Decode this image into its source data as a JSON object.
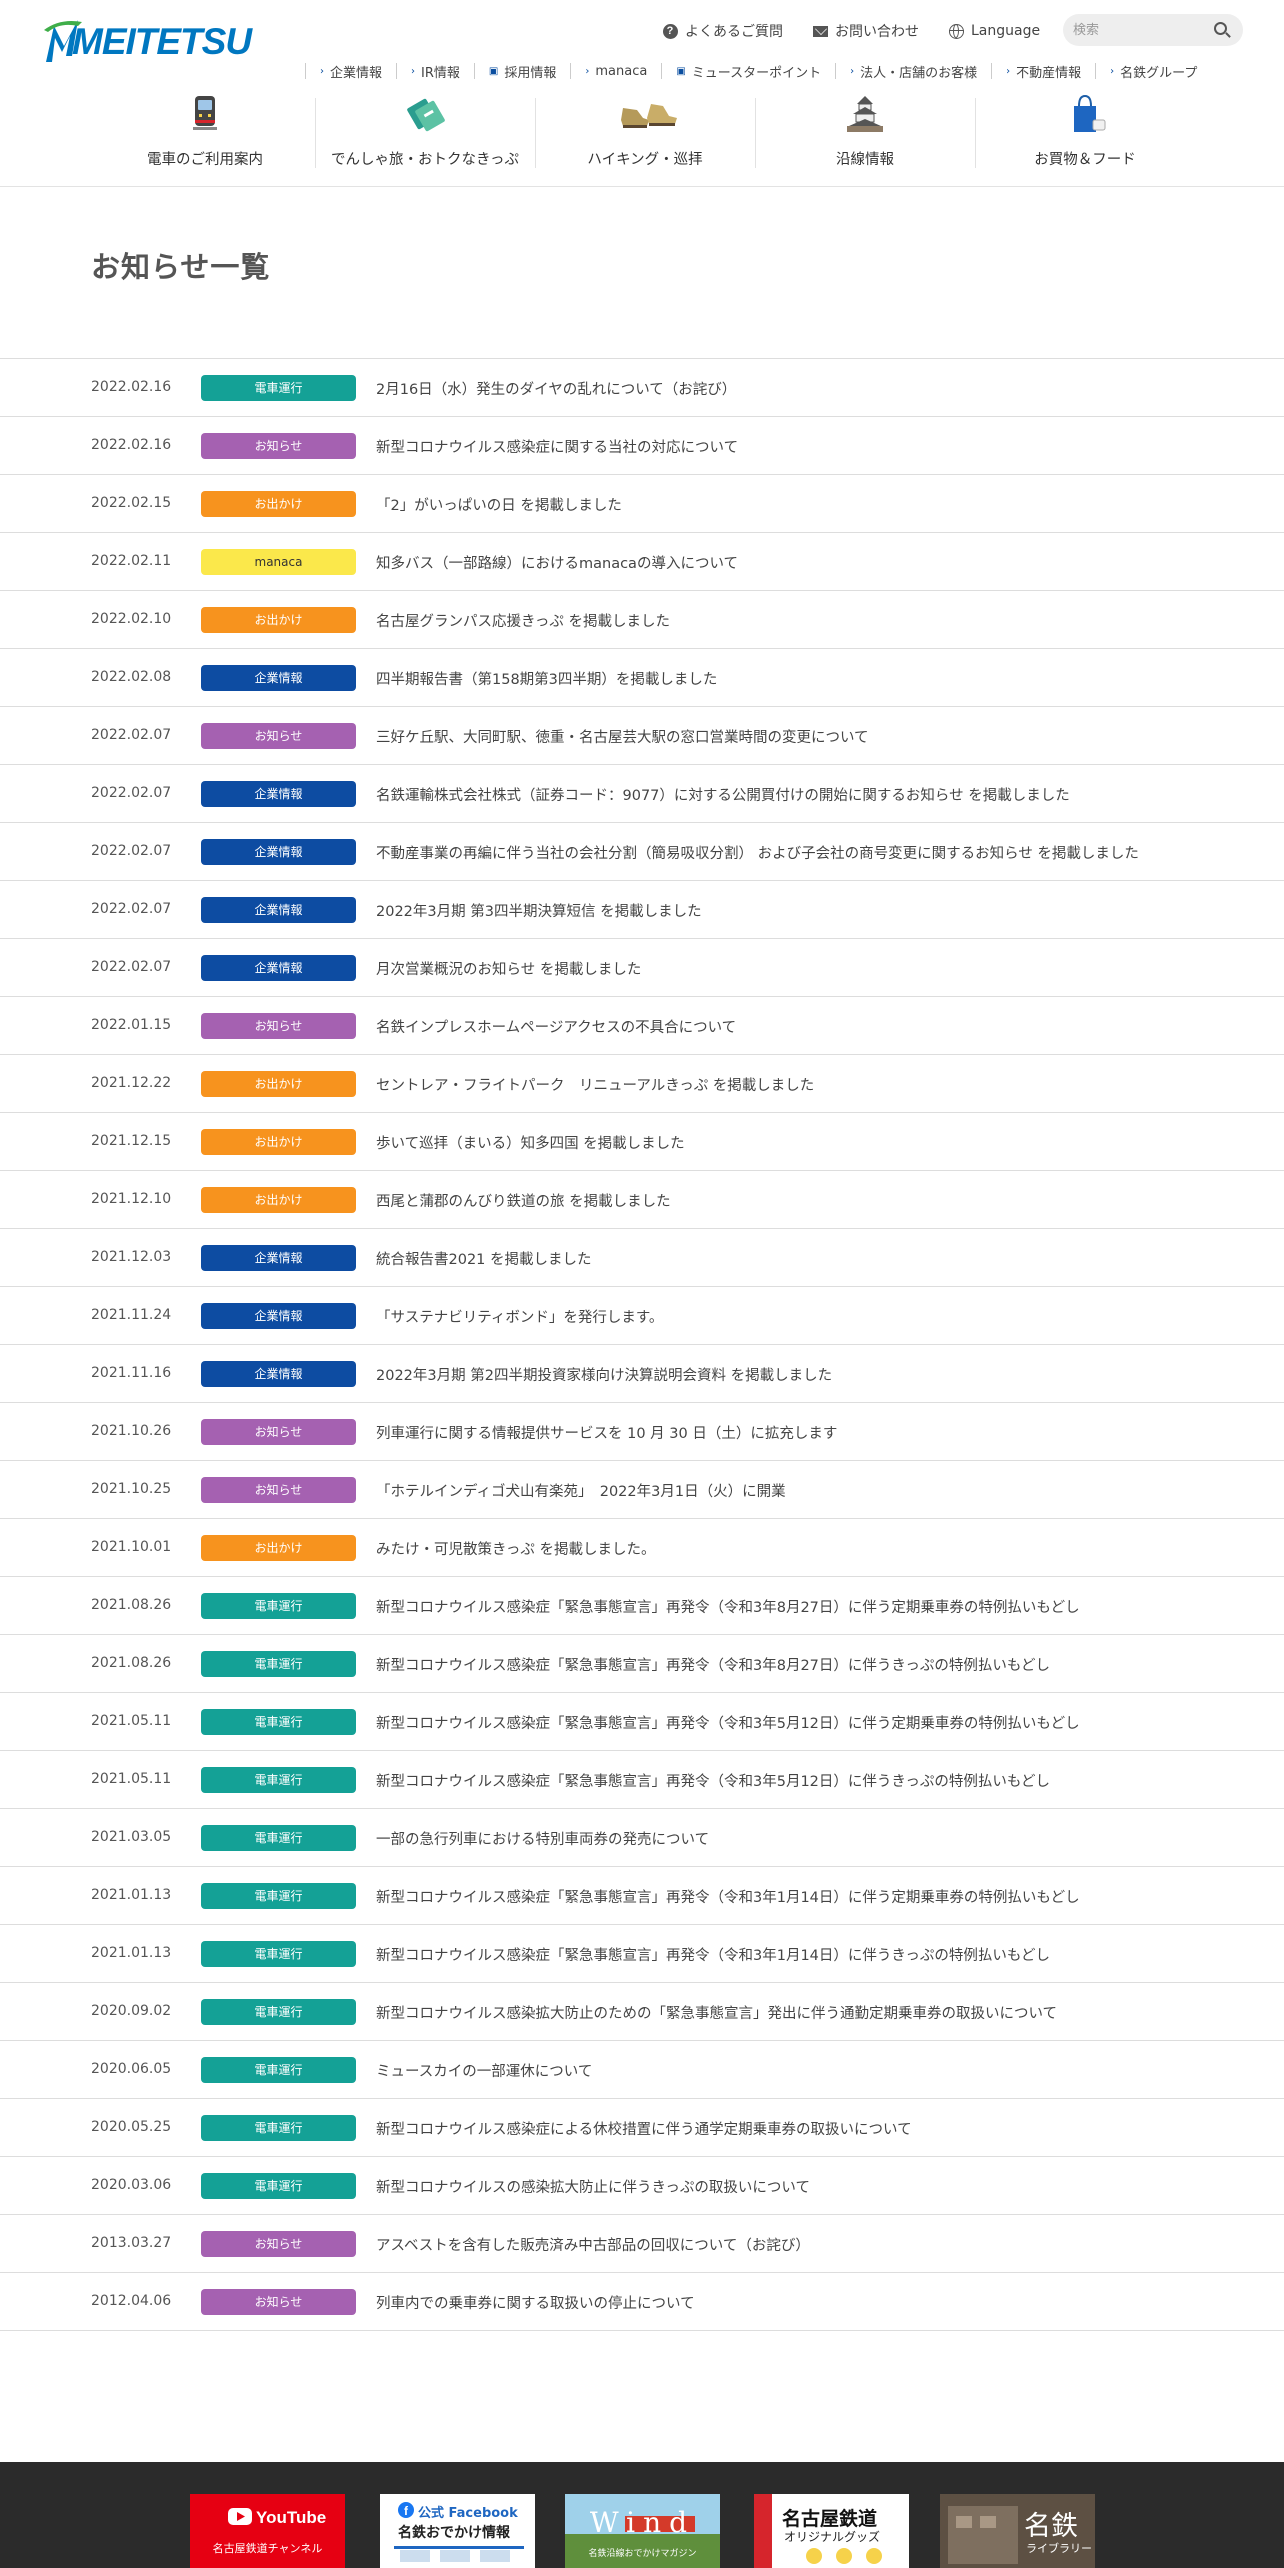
{
  "logo": {
    "text": "MEITETSU"
  },
  "util": {
    "faq": "よくあるご質問",
    "contact": "お問い合わせ",
    "language": "Language",
    "search_placeholder": "検索"
  },
  "subnav": [
    "企業情報",
    "IR情報",
    "採用情報",
    "manaca",
    "ミュースターポイント",
    "法人・店舗のお客様",
    "不動産情報",
    "名鉄グループ"
  ],
  "mainnav": [
    {
      "label": "電車のご利用案内",
      "icon": "train-icon"
    },
    {
      "label": "でんしゃ旅・おトクなきっぷ",
      "icon": "ticket-icon"
    },
    {
      "label": "ハイキング・巡拝",
      "icon": "hiking-boots-icon"
    },
    {
      "label": "沿線情報",
      "icon": "castle-icon"
    },
    {
      "label": "お買物＆フード",
      "icon": "shopping-bag-icon"
    }
  ],
  "page_title": "お知らせ一覧",
  "news": [
    {
      "date": "2022.02.16",
      "tag": "電車運行",
      "type": "train",
      "title": "2月16日（水）発生のダイヤの乱れについて（お詫び）"
    },
    {
      "date": "2022.02.16",
      "tag": "お知らせ",
      "type": "notice",
      "title": "新型コロナウイルス感染症に関する当社の対応について"
    },
    {
      "date": "2022.02.15",
      "tag": "お出かけ",
      "type": "outing",
      "title": "「2」がいっぱいの日 を掲載しました"
    },
    {
      "date": "2022.02.11",
      "tag": "manaca",
      "type": "manaca",
      "title": "知多バス（一部路線）におけるmanacaの導入について"
    },
    {
      "date": "2022.02.10",
      "tag": "お出かけ",
      "type": "outing",
      "title": "名古屋グランパス応援きっぷ を掲載しました"
    },
    {
      "date": "2022.02.08",
      "tag": "企業情報",
      "type": "corp",
      "title": "四半期報告書（第158期第3四半期）を掲載しました"
    },
    {
      "date": "2022.02.07",
      "tag": "お知らせ",
      "type": "notice",
      "title": "三好ケ丘駅、大同町駅、徳重・名古屋芸大駅の窓口営業時間の変更について"
    },
    {
      "date": "2022.02.07",
      "tag": "企業情報",
      "type": "corp",
      "title": "名鉄運輸株式会社株式（証券コード：9077）に対する公開買付けの開始に関するお知らせ を掲載しました"
    },
    {
      "date": "2022.02.07",
      "tag": "企業情報",
      "type": "corp",
      "title": "不動産事業の再編に伴う当社の会社分割（簡易吸収分割） および子会社の商号変更に関するお知らせ を掲載しました"
    },
    {
      "date": "2022.02.07",
      "tag": "企業情報",
      "type": "corp",
      "title": "2022年3月期 第3四半期決算短信 を掲載しました"
    },
    {
      "date": "2022.02.07",
      "tag": "企業情報",
      "type": "corp",
      "title": "月次営業概況のお知らせ を掲載しました"
    },
    {
      "date": "2022.01.15",
      "tag": "お知らせ",
      "type": "notice",
      "title": "名鉄インプレスホームページアクセスの不具合について"
    },
    {
      "date": "2021.12.22",
      "tag": "お出かけ",
      "type": "outing",
      "title": "セントレア・フライトパーク　リニューアルきっぷ を掲載しました"
    },
    {
      "date": "2021.12.15",
      "tag": "お出かけ",
      "type": "outing",
      "title": "歩いて巡拝（まいる）知多四国 を掲載しました"
    },
    {
      "date": "2021.12.10",
      "tag": "お出かけ",
      "type": "outing",
      "title": "西尾と蒲郡のんびり鉄道の旅 を掲載しました"
    },
    {
      "date": "2021.12.03",
      "tag": "企業情報",
      "type": "corp",
      "title": "統合報告書2021 を掲載しました"
    },
    {
      "date": "2021.11.24",
      "tag": "企業情報",
      "type": "corp",
      "title": "「サステナビリティボンド」を発行します。"
    },
    {
      "date": "2021.11.16",
      "tag": "企業情報",
      "type": "corp",
      "title": "2022年3月期 第2四半期投資家様向け決算説明会資料 を掲載しました"
    },
    {
      "date": "2021.10.26",
      "tag": "お知らせ",
      "type": "notice",
      "title": "列車運行に関する情報提供サービスを 10 月 30 日（土）に拡充します"
    },
    {
      "date": "2021.10.25",
      "tag": "お知らせ",
      "type": "notice",
      "title": "「ホテルインディゴ犬山有楽苑」　2022年3月1日（火）に開業"
    },
    {
      "date": "2021.10.01",
      "tag": "お出かけ",
      "type": "outing",
      "title": "みたけ・可児散策きっぷ を掲載しました。"
    },
    {
      "date": "2021.08.26",
      "tag": "電車運行",
      "type": "train",
      "title": "新型コロナウイルス感染症「緊急事態宣言」再発令（令和3年8月27日）に伴う定期乗車券の特例払いもどし"
    },
    {
      "date": "2021.08.26",
      "tag": "電車運行",
      "type": "train",
      "title": "新型コロナウイルス感染症「緊急事態宣言」再発令（令和3年8月27日）に伴うきっぷの特例払いもどし"
    },
    {
      "date": "2021.05.11",
      "tag": "電車運行",
      "type": "train",
      "title": "新型コロナウイルス感染症「緊急事態宣言」再発令（令和3年5月12日）に伴う定期乗車券の特例払いもどし"
    },
    {
      "date": "2021.05.11",
      "tag": "電車運行",
      "type": "train",
      "title": "新型コロナウイルス感染症「緊急事態宣言」再発令（令和3年5月12日）に伴うきっぷの特例払いもどし"
    },
    {
      "date": "2021.03.05",
      "tag": "電車運行",
      "type": "train",
      "title": "一部の急行列車における特別車両券の発売について"
    },
    {
      "date": "2021.01.13",
      "tag": "電車運行",
      "type": "train",
      "title": "新型コロナウイルス感染症「緊急事態宣言」再発令（令和3年1月14日）に伴う定期乗車券の特例払いもどし"
    },
    {
      "date": "2021.01.13",
      "tag": "電車運行",
      "type": "train",
      "title": "新型コロナウイルス感染症「緊急事態宣言」再発令（令和3年1月14日）に伴うきっぷの特例払いもどし"
    },
    {
      "date": "2020.09.02",
      "tag": "電車運行",
      "type": "train",
      "title": "新型コロナウイルス感染拡大防止のための「緊急事態宣言」発出に伴う通勤定期乗車券の取扱いについて"
    },
    {
      "date": "2020.06.05",
      "tag": "電車運行",
      "type": "train",
      "title": "ミュースカイの一部運休について"
    },
    {
      "date": "2020.05.25",
      "tag": "電車運行",
      "type": "train",
      "title": "新型コロナウイルス感染症による休校措置に伴う通学定期乗車券の取扱いについて"
    },
    {
      "date": "2020.03.06",
      "tag": "電車運行",
      "type": "train",
      "title": "新型コロナウイルスの感染拡大防止に伴うきっぷの取扱いについて"
    },
    {
      "date": "2013.03.27",
      "tag": "お知らせ",
      "type": "notice",
      "title": "アスベストを含有した販売済み中古部品の回収について（お詫び）"
    },
    {
      "date": "2012.04.06",
      "tag": "お知らせ",
      "type": "notice",
      "title": "列車内での乗車券に関する取扱いの停止について"
    }
  ],
  "footer_banners": [
    {
      "name": "youtube-banner",
      "line1": "YouTube",
      "line2": "名古屋鉄道チャンネル"
    },
    {
      "name": "facebook-banner",
      "line1": "公式 Facebook",
      "line2": "名鉄おでかけ情報"
    },
    {
      "name": "wind-banner",
      "line1": "Wind",
      "line2": "名鉄沿線おでかけマガジン"
    },
    {
      "name": "goods-banner",
      "line1": "名古屋鉄道",
      "line2": "オリジナルグッズ"
    },
    {
      "name": "library-banner",
      "line1": "名鉄",
      "line2": "ライブラリー"
    }
  ],
  "colors": {
    "brand": "#0077c0",
    "train": "#14a196",
    "notice": "#a561b1",
    "outing": "#f7931e",
    "corp": "#0d4ca2",
    "manaca": "#fbe84b"
  }
}
